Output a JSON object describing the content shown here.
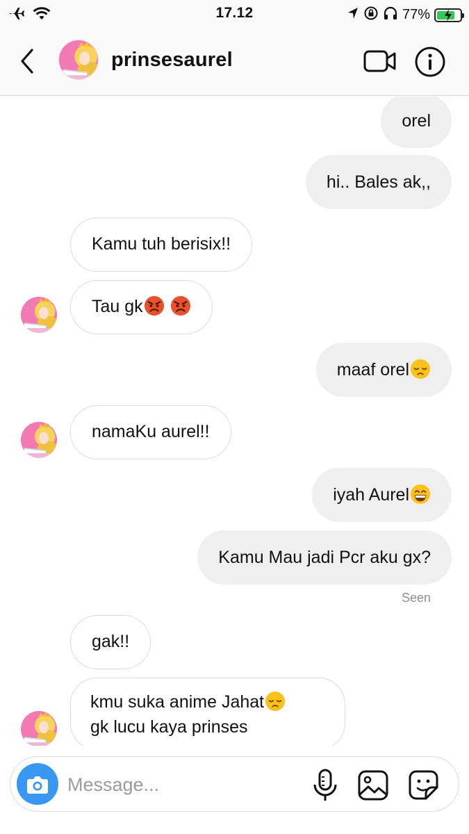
{
  "status_bar": {
    "time": "17.12",
    "battery_text": "77%",
    "battery_level": 0.77,
    "icons": [
      "airplane-icon",
      "wifi-icon",
      "location-arrow-icon",
      "rotation-lock-icon",
      "headphones-icon",
      "battery-charging-icon"
    ]
  },
  "header": {
    "username": "prinsesaurel",
    "icons": [
      "back-chevron-icon",
      "video-camera-icon",
      "info-icon"
    ]
  },
  "messages": [
    {
      "direction": "out",
      "text": "orel"
    },
    {
      "direction": "out",
      "text": "hi.. Bales ak,,"
    },
    {
      "direction": "in",
      "text": "Kamu tuh berisix!!"
    },
    {
      "direction": "in",
      "text": "Tau gk",
      "emoji": [
        "angry-face",
        "angry-face"
      ]
    },
    {
      "direction": "out",
      "text": "maaf orel",
      "emoji": [
        "pensive-face"
      ]
    },
    {
      "direction": "in",
      "text": "namaKu aurel!!"
    },
    {
      "direction": "out",
      "text": "iyah Aurel",
      "emoji": [
        "grinning-face"
      ]
    },
    {
      "direction": "out",
      "text": "Kamu Mau jadi Pcr aku gx?"
    },
    {
      "direction": "in",
      "text": "gak!!"
    },
    {
      "direction": "in",
      "line1": "kmu suka anime Jahat",
      "line2": "gk lucu kaya prinses",
      "emoji": [
        "pensive-face"
      ]
    }
  ],
  "seen_label": "Seen",
  "composer": {
    "placeholder": "Message...",
    "value": "",
    "icons": [
      "camera-icon",
      "microphone-icon",
      "gallery-icon",
      "sticker-icon"
    ]
  },
  "colors": {
    "camera_button": "#3897f0",
    "outgoing_bubble": "#efefef",
    "incoming_border": "#dbdbdb",
    "seen_text": "#8e8e8e",
    "battery_green": "#34c759"
  }
}
